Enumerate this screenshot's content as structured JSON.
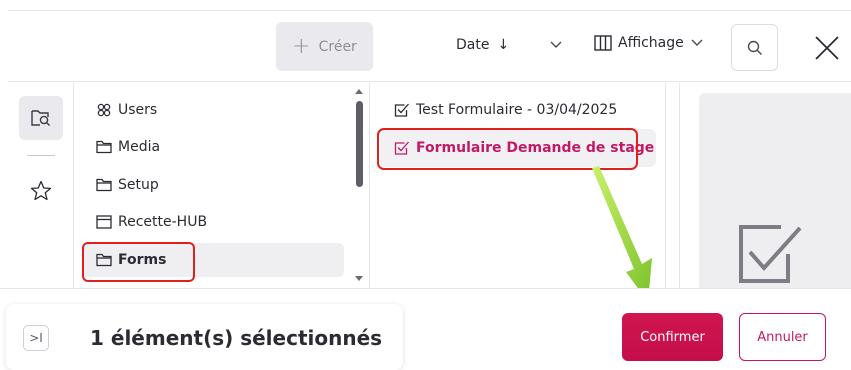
{
  "toolbar": {
    "create_label": "Créer",
    "sort_label": "Date",
    "sort_direction_glyph": "↓",
    "display_label": "Affichage",
    "icons": [
      "plus-icon",
      "chevron-down-icon",
      "columns-icon",
      "search-icon",
      "close-icon"
    ]
  },
  "rail": {
    "icons": [
      "folder-browse-icon",
      "star-icon"
    ]
  },
  "folders": {
    "items": [
      {
        "label": "Users",
        "icon": "users-group-icon"
      },
      {
        "label": "Media",
        "icon": "folder-icon"
      },
      {
        "label": "Setup",
        "icon": "folder-icon"
      },
      {
        "label": "Recette-HUB",
        "icon": "window-icon"
      },
      {
        "label": "Forms",
        "icon": "folder-icon",
        "selected": true
      }
    ]
  },
  "forms": {
    "items": [
      {
        "label": "Test Formulaire - 03/04/2025",
        "icon": "checkbox-icon"
      },
      {
        "label": "Formulaire Demande de stage",
        "icon": "checkbox-icon",
        "selected": true
      }
    ]
  },
  "preview": {
    "icon": "checkbox-large-icon"
  },
  "footer": {
    "selection_text": "1 élément(s) sélectionnés",
    "expand_glyph": ">I",
    "confirm_label": "Confirmer",
    "cancel_label": "Annuler"
  },
  "colors": {
    "accent": "#c8126a",
    "confirm_bg": "#cc1350",
    "highlight_box": "#e0201f",
    "annotation_arrow": "#8fd13a"
  }
}
